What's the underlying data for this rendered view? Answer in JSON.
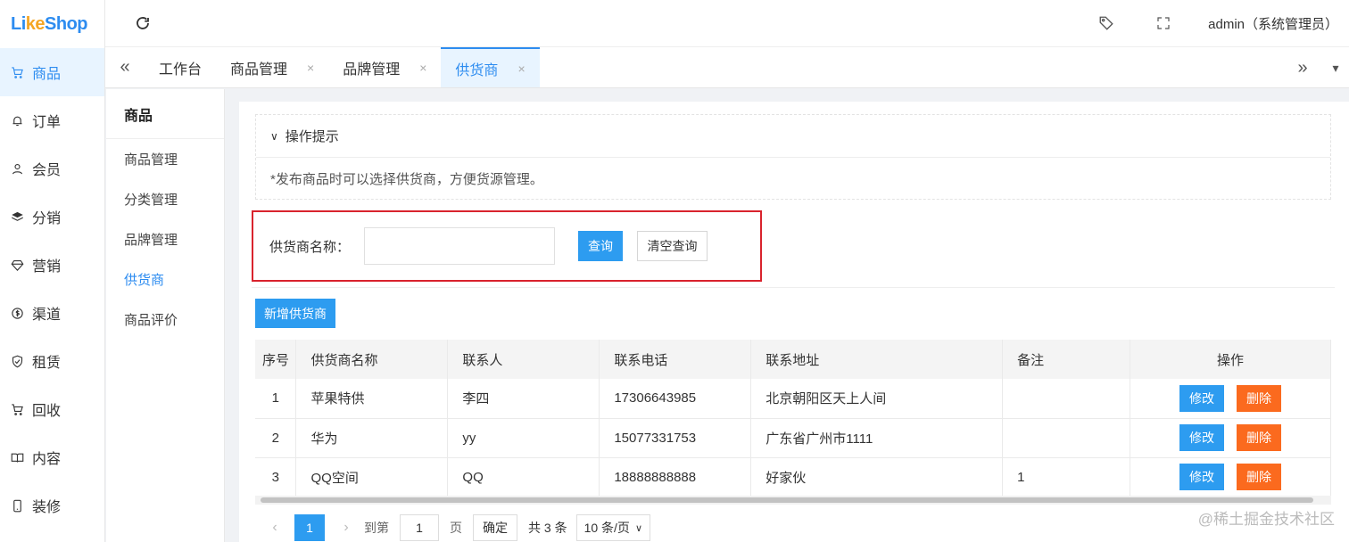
{
  "app": {
    "logo_pre": "Li",
    "logo_k": "ke",
    "logo_post": "Shop"
  },
  "nav": [
    {
      "label": "商品",
      "icon": "cart-icon",
      "active": true
    },
    {
      "label": "订单",
      "icon": "bell-icon"
    },
    {
      "label": "会员",
      "icon": "user-icon"
    },
    {
      "label": "分销",
      "icon": "layers-icon"
    },
    {
      "label": "营销",
      "icon": "diamond-icon"
    },
    {
      "label": "渠道",
      "icon": "coin-icon"
    },
    {
      "label": "租赁",
      "icon": "shield-icon"
    },
    {
      "label": "回收",
      "icon": "cart-icon"
    },
    {
      "label": "内容",
      "icon": "book-icon"
    },
    {
      "label": "装修",
      "icon": "phone-icon"
    }
  ],
  "header": {
    "user": "admin（系统管理员）"
  },
  "tabs": [
    {
      "label": "工作台",
      "closable": false
    },
    {
      "label": "商品管理",
      "closable": true
    },
    {
      "label": "品牌管理",
      "closable": true
    },
    {
      "label": "供货商",
      "closable": true,
      "active": true
    }
  ],
  "tab_close": "×",
  "subnav": {
    "title": "商品",
    "items": [
      "商品管理",
      "分类管理",
      "品牌管理",
      "供货商",
      "商品评价"
    ]
  },
  "tips": {
    "title": "操作提示",
    "text": "*发布商品时可以选择供货商，方便货源管理。"
  },
  "search": {
    "label": "供货商名称：",
    "value": "",
    "query_btn": "查询",
    "clear_btn": "清空查询"
  },
  "add_btn": "新增供货商",
  "table": {
    "headers": [
      "序号",
      "供货商名称",
      "联系人",
      "联系电话",
      "联系地址",
      "备注",
      "操作"
    ],
    "rows": [
      {
        "no": "1",
        "name": "苹果特供",
        "contact": "李四",
        "phone": "17306643985",
        "address": "北京朝阳区天上人间",
        "note": ""
      },
      {
        "no": "2",
        "name": "华为",
        "contact": "yy",
        "phone": "15077331753",
        "address": "广东省广州市1111",
        "note": ""
      },
      {
        "no": "3",
        "name": "QQ空间",
        "contact": "QQ",
        "phone": "18888888888",
        "address": "好家伙",
        "note": "1"
      }
    ],
    "edit_label": "修改",
    "delete_label": "删除"
  },
  "pager": {
    "current": "1",
    "goto_label": "到第",
    "goto_value": "1",
    "page_unit": "页",
    "confirm": "确定",
    "total": "共 3 条",
    "page_size": "10 条/页"
  },
  "watermark": "@稀土掘金技术社区"
}
